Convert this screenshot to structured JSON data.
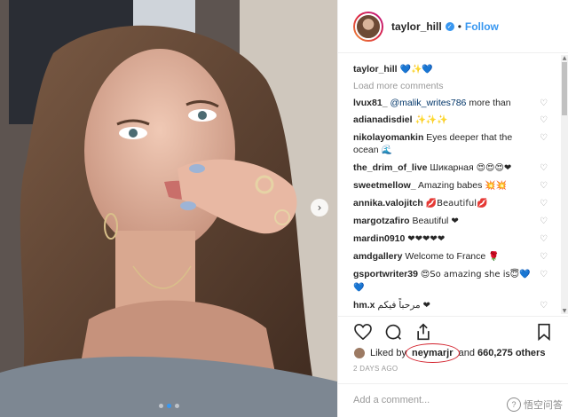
{
  "header": {
    "username": "taylor_hill",
    "separator": "•",
    "follow_label": "Follow",
    "verified_glyph": "✓"
  },
  "caption": {
    "username": "taylor_hill",
    "emojis": "💙✨💙"
  },
  "load_more_label": "Load more comments",
  "comments": [
    {
      "user": "lvux81_",
      "mention": "@malik_writes786",
      "text": " more than",
      "emojis": ""
    },
    {
      "user": "adianadisdiel",
      "mention": "",
      "text": "",
      "emojis": "✨✨✨"
    },
    {
      "user": "nikolayomankin",
      "mention": "",
      "text": "Eyes deeper that the ocean",
      "emojis": "🌊"
    },
    {
      "user": "the_drim_of_live",
      "mention": "",
      "text": "Шикарная",
      "emojis": "😍😍😍❤"
    },
    {
      "user": "sweetmellow_",
      "mention": "",
      "text": "Amazing babes",
      "emojis": "💥💥"
    },
    {
      "user": "annika.valojitch",
      "mention": "",
      "text": "",
      "emojis": "💋Beautiful💋"
    },
    {
      "user": "margotzafiro",
      "mention": "",
      "text": "Beautiful",
      "emojis": "❤"
    },
    {
      "user": "mardin0910",
      "mention": "",
      "text": "",
      "emojis": "❤❤❤❤❤"
    },
    {
      "user": "amdgallery",
      "mention": "",
      "text": "Welcome to France",
      "emojis": "🌹"
    },
    {
      "user": "gsportwriter39",
      "mention": "",
      "text": "",
      "emojis": "😍So amazing she is😇💙💙"
    },
    {
      "user": "hm.x",
      "mention": "",
      "text": "مرحباً فيكم",
      "emojis": "❤"
    }
  ],
  "icons": {
    "like": "heart-icon",
    "comment": "comment-icon",
    "share": "share-icon",
    "save": "bookmark-icon",
    "comment_like": "♡"
  },
  "likes": {
    "prefix": "Liked by",
    "liker": "neymarjr",
    "middle": "and",
    "count_text": "660,275 others"
  },
  "timestamp": "2 DAYS AGO",
  "add_comment_placeholder": "Add a comment...",
  "watermark": {
    "logo_glyph": "?",
    "text": "悟空问答"
  },
  "nav_arrow": "›",
  "colors": {
    "accent": "#3897f0",
    "highlight_circle": "#d21f2a",
    "muted": "#999999"
  },
  "carousel": {
    "dot_count": 3,
    "active_index": 1
  }
}
